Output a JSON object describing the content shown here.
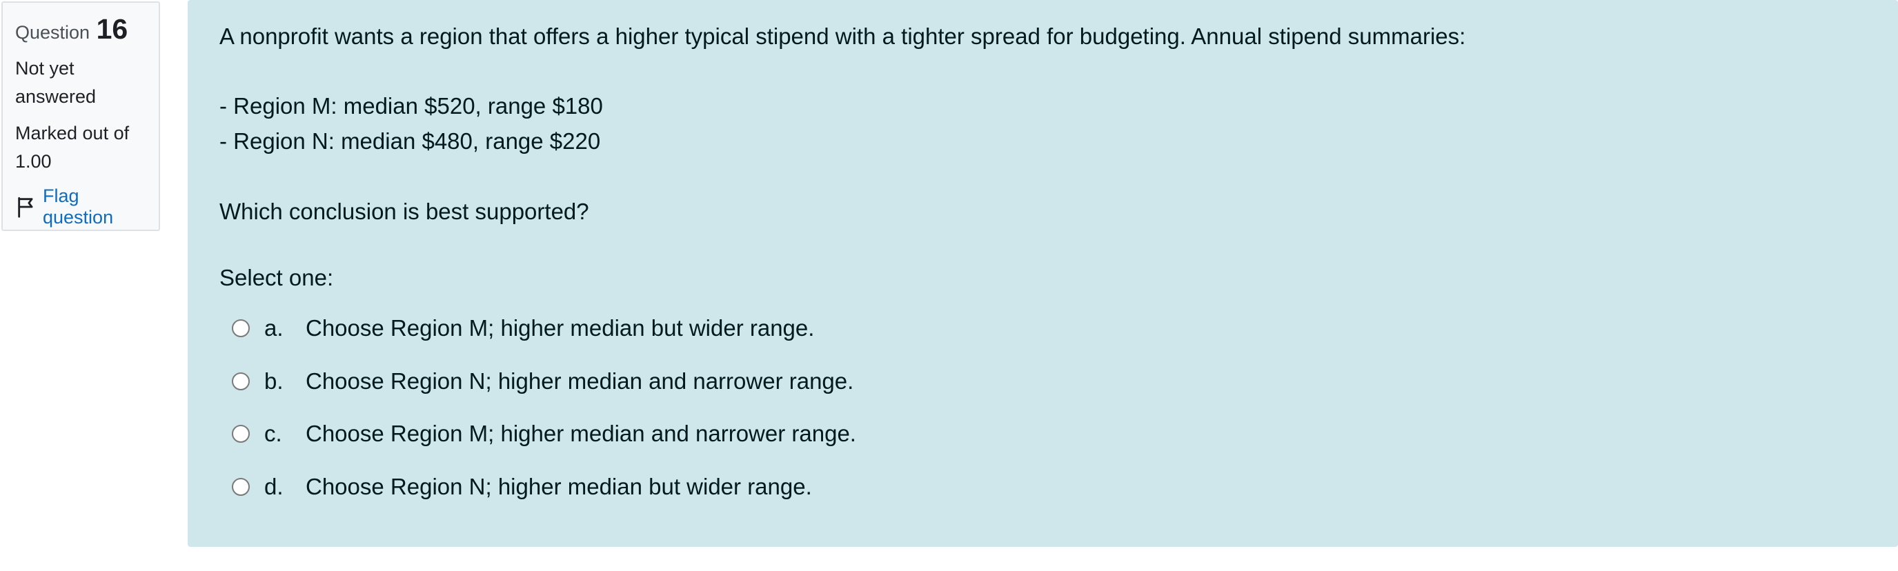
{
  "info": {
    "question_label": "Question",
    "question_number": "16",
    "state": "Not yet answered",
    "grade": "Marked out of 1.00",
    "flag_label": "Flag question",
    "flag_icon": "flag-icon",
    "link_color": "#0f6cbf"
  },
  "question": {
    "text": "A nonprofit wants a region that offers a higher typical stipend with a tighter spread for budgeting. Annual stipend summaries:",
    "bullets": [
      "- Region M: median $520, range $180",
      "- Region N: median $480, range $220"
    ],
    "ask": "Which conclusion is best supported?",
    "select_prompt": "Select one:",
    "background_color": "#cfe6ea",
    "options": [
      {
        "letter": "a.",
        "text": "Choose Region M; higher median but wider range."
      },
      {
        "letter": "b.",
        "text": "Choose Region N; higher median and narrower range."
      },
      {
        "letter": "c.",
        "text": "Choose Region M; higher median and narrower range."
      },
      {
        "letter": "d.",
        "text": "Choose Region N; higher median but wider range."
      }
    ]
  }
}
